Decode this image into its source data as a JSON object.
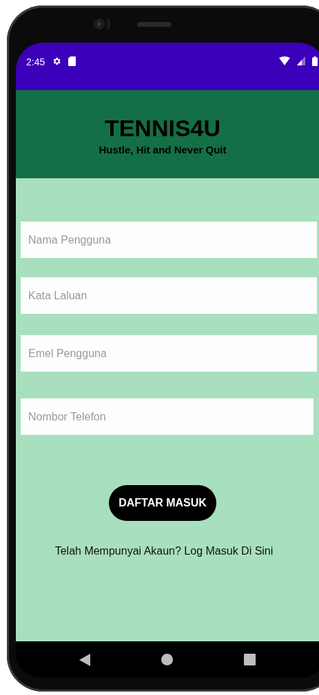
{
  "status_bar": {
    "time": "2:45"
  },
  "header": {
    "title": "TENNIS4U",
    "subtitle": "Hustle, Hit and Never Quit"
  },
  "form": {
    "fields": [
      {
        "placeholder": "Nama Pengguna"
      },
      {
        "placeholder": "Kata Laluan"
      },
      {
        "placeholder": "Emel Pengguna"
      },
      {
        "placeholder": "Nombor Telefon"
      }
    ],
    "submit_button": "DAFTAR MASUK",
    "login_link": "Telah Mempunyai Akaun? Log Masuk Di Sini"
  }
}
